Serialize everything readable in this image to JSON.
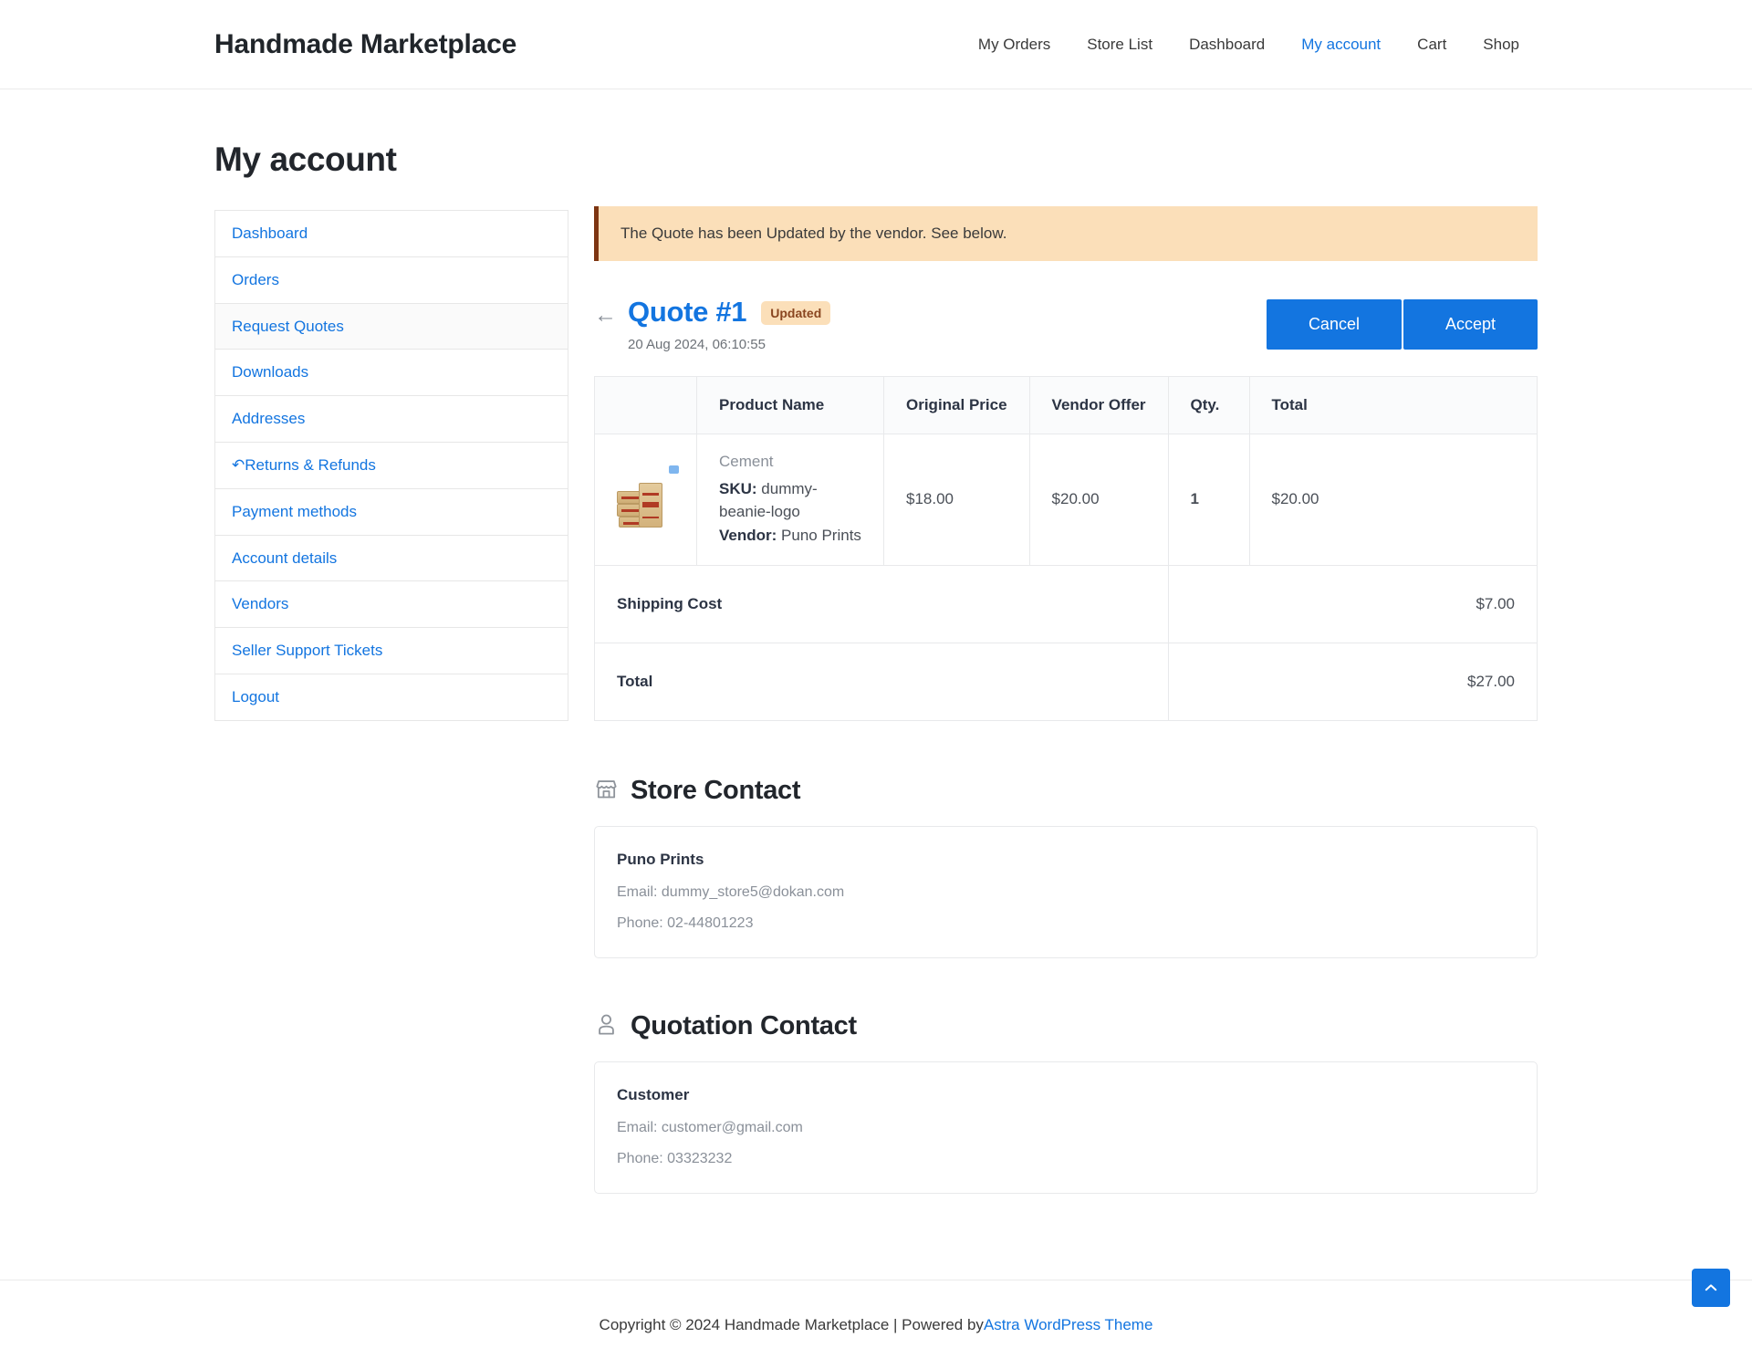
{
  "header": {
    "brand": "Handmade Marketplace",
    "nav": [
      {
        "label": "My Orders",
        "active": false
      },
      {
        "label": "Store List",
        "active": false
      },
      {
        "label": "Dashboard",
        "active": false
      },
      {
        "label": "My account",
        "active": true
      },
      {
        "label": "Cart",
        "active": false
      },
      {
        "label": "Shop",
        "active": false
      }
    ]
  },
  "page": {
    "title": "My account"
  },
  "sidebar": {
    "items": [
      {
        "label": "Dashboard"
      },
      {
        "label": "Orders"
      },
      {
        "label": "Request Quotes"
      },
      {
        "label": "Downloads"
      },
      {
        "label": "Addresses"
      },
      {
        "label": "Returns & Refunds",
        "icon": "return-arrow-icon"
      },
      {
        "label": "Payment methods"
      },
      {
        "label": "Account details"
      },
      {
        "label": "Vendors"
      },
      {
        "label": "Seller Support Tickets"
      },
      {
        "label": "Logout"
      }
    ],
    "active_index": 2
  },
  "alert": {
    "message": "The Quote has been Updated by the vendor. See below.",
    "background": "#fbdfb9",
    "border_color": "#7d3512"
  },
  "quote": {
    "back_icon": "arrow-left-icon",
    "title": "Quote #1",
    "status_badge": "Updated",
    "date": "20 Aug 2024, 06:10:55",
    "cancel_label": "Cancel",
    "accept_label": "Accept",
    "accent_color": "#1375e0",
    "table": {
      "columns": [
        "",
        "Product Name",
        "Original Price",
        "Vendor Offer",
        "Qty.",
        "Total"
      ],
      "rows": [
        {
          "thumbnail": "cement-bags-product-image",
          "product_name": "Cement",
          "sku_label": "SKU:",
          "sku_value": "dummy-beanie-logo",
          "vendor_label": "Vendor:",
          "vendor_value": "Puno Prints",
          "original_price": "$18.00",
          "vendor_offer": "$20.00",
          "qty": "1",
          "total": "$20.00"
        }
      ],
      "summary": [
        {
          "label": "Shipping Cost",
          "value": "$7.00"
        },
        {
          "label": "Total",
          "value": "$27.00"
        }
      ]
    }
  },
  "store_contact": {
    "icon": "storefront-icon",
    "heading": "Store Contact",
    "name": "Puno Prints",
    "email": "Email: dummy_store5@dokan.com",
    "phone": "Phone: 02-44801223"
  },
  "quotation_contact": {
    "icon": "person-icon",
    "heading": "Quotation Contact",
    "name": "Customer",
    "email": "Email: customer@gmail.com",
    "phone": "Phone: 03323232"
  },
  "footer": {
    "text": "Copyright © 2024 Handmade Marketplace | Powered by ",
    "link": "Astra WordPress Theme"
  },
  "scroll_top": {
    "icon": "chevron-up-icon"
  }
}
